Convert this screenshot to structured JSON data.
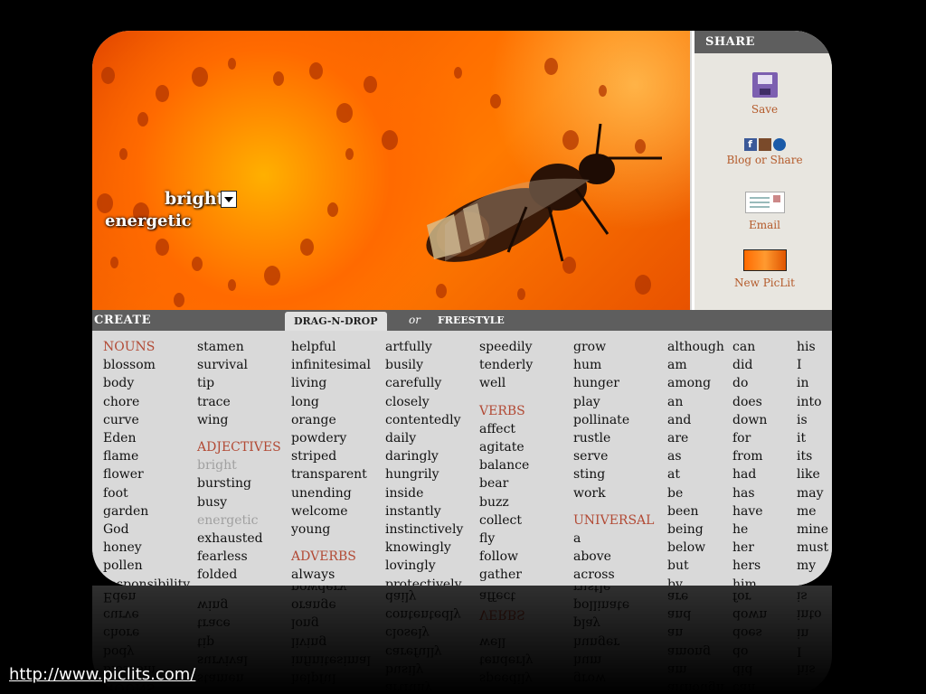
{
  "photo": {
    "overlay_words": [
      "bright",
      "energetic"
    ]
  },
  "share": {
    "title": "SHARE",
    "items": [
      {
        "label": "Save",
        "icon": "save-icon"
      },
      {
        "label": "Blog or Share",
        "icon": "social-icons"
      },
      {
        "label": "Email",
        "icon": "email-icon"
      },
      {
        "label": "New PicLit",
        "icon": "new-piclit-icon"
      }
    ]
  },
  "create": {
    "title": "CREATE",
    "tab_active": "DRAG-N-DROP",
    "or": "or",
    "tab_other": "FREESTYLE"
  },
  "columns": [
    [
      {
        "t": "NOUNS",
        "h": true
      },
      {
        "t": "blossom"
      },
      {
        "t": "body"
      },
      {
        "t": "chore"
      },
      {
        "t": "curve"
      },
      {
        "t": "Eden"
      },
      {
        "t": "flame"
      },
      {
        "t": "flower"
      },
      {
        "t": "foot"
      },
      {
        "t": "garden"
      },
      {
        "t": "God"
      },
      {
        "t": "honey"
      },
      {
        "t": "pollen"
      },
      {
        "t": "responsibility"
      }
    ],
    [
      {
        "t": "stamen"
      },
      {
        "t": "survival"
      },
      {
        "t": "tip"
      },
      {
        "t": "trace"
      },
      {
        "t": "wing"
      },
      {
        "gap": true
      },
      {
        "t": "ADJECTIVES",
        "h": true
      },
      {
        "t": "bright",
        "u": true
      },
      {
        "t": "bursting"
      },
      {
        "t": "busy"
      },
      {
        "t": "energetic",
        "u": true
      },
      {
        "t": "exhausted"
      },
      {
        "t": "fearless"
      },
      {
        "t": "folded"
      }
    ],
    [
      {
        "t": "helpful"
      },
      {
        "t": "infinitesimal"
      },
      {
        "t": "living"
      },
      {
        "t": "long"
      },
      {
        "t": "orange"
      },
      {
        "t": "powdery"
      },
      {
        "t": "striped"
      },
      {
        "t": "transparent"
      },
      {
        "t": "unending"
      },
      {
        "t": "welcome"
      },
      {
        "t": "young"
      },
      {
        "gap": true
      },
      {
        "t": "ADVERBS",
        "h": true
      },
      {
        "t": "always"
      }
    ],
    [
      {
        "t": "artfully"
      },
      {
        "t": "busily"
      },
      {
        "t": "carefully"
      },
      {
        "t": "closely"
      },
      {
        "t": "contentedly"
      },
      {
        "t": "daily"
      },
      {
        "t": "daringly"
      },
      {
        "t": "hungrily"
      },
      {
        "t": "inside"
      },
      {
        "t": "instantly"
      },
      {
        "t": "instinctively"
      },
      {
        "t": "knowingly"
      },
      {
        "t": "lovingly"
      },
      {
        "t": "protectively"
      }
    ],
    [
      {
        "t": "speedily"
      },
      {
        "t": "tenderly"
      },
      {
        "t": "well"
      },
      {
        "gap": true
      },
      {
        "t": "VERBS",
        "h": true
      },
      {
        "t": "affect"
      },
      {
        "t": "agitate"
      },
      {
        "t": "balance"
      },
      {
        "t": "bear"
      },
      {
        "t": "buzz"
      },
      {
        "t": "collect"
      },
      {
        "t": "fly"
      },
      {
        "t": "follow"
      },
      {
        "t": "gather"
      }
    ],
    [
      {
        "t": "grow"
      },
      {
        "t": "hum"
      },
      {
        "t": "hunger"
      },
      {
        "t": "play"
      },
      {
        "t": "pollinate"
      },
      {
        "t": "rustle"
      },
      {
        "t": "serve"
      },
      {
        "t": "sting"
      },
      {
        "t": "work"
      },
      {
        "gap": true
      },
      {
        "t": "UNIVERSAL",
        "h": true
      },
      {
        "t": "a"
      },
      {
        "t": "above"
      },
      {
        "t": "across"
      }
    ],
    [
      {
        "t": "although"
      },
      {
        "t": "am"
      },
      {
        "t": "among"
      },
      {
        "t": "an"
      },
      {
        "t": "and"
      },
      {
        "t": "are"
      },
      {
        "t": "as"
      },
      {
        "t": "at"
      },
      {
        "t": "be"
      },
      {
        "t": "been"
      },
      {
        "t": "being"
      },
      {
        "t": "below"
      },
      {
        "t": "but"
      },
      {
        "t": "by"
      }
    ],
    [
      {
        "t": "can"
      },
      {
        "t": "did"
      },
      {
        "t": "do"
      },
      {
        "t": "does"
      },
      {
        "t": "down"
      },
      {
        "t": "for"
      },
      {
        "t": "from"
      },
      {
        "t": "had"
      },
      {
        "t": "has"
      },
      {
        "t": "have"
      },
      {
        "t": "he"
      },
      {
        "t": "her"
      },
      {
        "t": "hers"
      },
      {
        "t": "him"
      }
    ],
    [
      {
        "t": "his"
      },
      {
        "t": "I"
      },
      {
        "t": "in"
      },
      {
        "t": "into"
      },
      {
        "t": "is"
      },
      {
        "t": "it"
      },
      {
        "t": "its"
      },
      {
        "t": "like"
      },
      {
        "t": "may"
      },
      {
        "t": "me"
      },
      {
        "t": "mine"
      },
      {
        "t": "must"
      },
      {
        "t": "my"
      }
    ]
  ],
  "footer_url": "http://www.piclits.com/"
}
